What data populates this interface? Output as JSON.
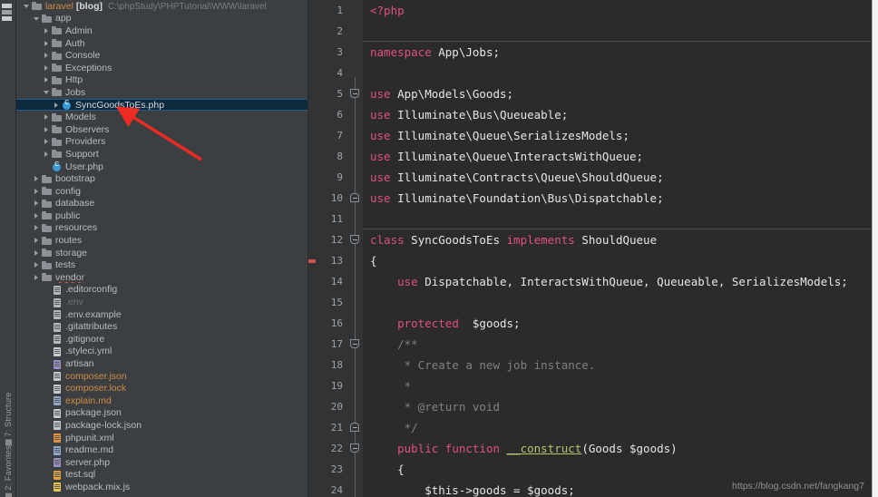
{
  "toolstrip": {
    "tabs": [
      {
        "label": "7: Structure",
        "icon": "structure-icon"
      },
      {
        "label": "2: Favorites",
        "icon": "favorites-icon"
      }
    ]
  },
  "project_tree": {
    "root": {
      "label": "laravel",
      "module": "[blog]",
      "path": "C:\\phpStudy\\PHPTutorial\\WWW\\laravel"
    },
    "items": [
      {
        "label": "laravel",
        "module": "[blog]",
        "path": "C:\\phpStudy\\PHPTutorial\\WWW\\laravel",
        "indent": 0,
        "twisty": "open",
        "icon": "folder-icon",
        "style": "root"
      },
      {
        "label": "app",
        "indent": 1,
        "twisty": "open",
        "icon": "folder-icon",
        "style": "normal"
      },
      {
        "label": "Admin",
        "indent": 2,
        "twisty": "closed",
        "icon": "folder-icon",
        "style": "normal"
      },
      {
        "label": "Auth",
        "indent": 2,
        "twisty": "closed",
        "icon": "folder-icon",
        "style": "normal"
      },
      {
        "label": "Console",
        "indent": 2,
        "twisty": "closed",
        "icon": "folder-icon",
        "style": "normal"
      },
      {
        "label": "Exceptions",
        "indent": 2,
        "twisty": "closed",
        "icon": "folder-icon",
        "style": "normal"
      },
      {
        "label": "Http",
        "indent": 2,
        "twisty": "closed",
        "icon": "folder-icon",
        "style": "normal"
      },
      {
        "label": "Jobs",
        "indent": 2,
        "twisty": "open",
        "icon": "folder-icon",
        "style": "normal"
      },
      {
        "label": "SyncGoodsToEs.php",
        "indent": 3,
        "twisty": "closed",
        "icon": "php-class-icon",
        "style": "selected"
      },
      {
        "label": "Models",
        "indent": 2,
        "twisty": "closed",
        "icon": "folder-icon",
        "style": "normal"
      },
      {
        "label": "Observers",
        "indent": 2,
        "twisty": "closed",
        "icon": "folder-icon",
        "style": "normal"
      },
      {
        "label": "Providers",
        "indent": 2,
        "twisty": "closed",
        "icon": "folder-icon",
        "style": "normal"
      },
      {
        "label": "Support",
        "indent": 2,
        "twisty": "closed",
        "icon": "folder-icon",
        "style": "normal"
      },
      {
        "label": "User.php",
        "indent": 2,
        "twisty": "none",
        "icon": "php-class-icon",
        "style": "normal"
      },
      {
        "label": "bootstrap",
        "indent": 1,
        "twisty": "closed",
        "icon": "folder-icon",
        "style": "normal"
      },
      {
        "label": "config",
        "indent": 1,
        "twisty": "closed",
        "icon": "folder-icon",
        "style": "normal"
      },
      {
        "label": "database",
        "indent": 1,
        "twisty": "closed",
        "icon": "folder-icon",
        "style": "normal"
      },
      {
        "label": "public",
        "indent": 1,
        "twisty": "closed",
        "icon": "folder-icon",
        "style": "normal"
      },
      {
        "label": "resources",
        "indent": 1,
        "twisty": "closed",
        "icon": "folder-icon",
        "style": "normal"
      },
      {
        "label": "routes",
        "indent": 1,
        "twisty": "closed",
        "icon": "folder-icon",
        "style": "normal"
      },
      {
        "label": "storage",
        "indent": 1,
        "twisty": "closed",
        "icon": "folder-icon",
        "style": "normal"
      },
      {
        "label": "tests",
        "indent": 1,
        "twisty": "closed",
        "icon": "folder-icon",
        "style": "normal"
      },
      {
        "label": "vendor",
        "indent": 1,
        "twisty": "closed",
        "icon": "folder-icon",
        "style": "wavy"
      },
      {
        "label": ".editorconfig",
        "indent": 2,
        "twisty": "none",
        "icon": "file-icon",
        "style": "normal"
      },
      {
        "label": ".env",
        "indent": 2,
        "twisty": "none",
        "icon": "file-icon",
        "style": "dim"
      },
      {
        "label": ".env.example",
        "indent": 2,
        "twisty": "none",
        "icon": "file-icon",
        "style": "normal"
      },
      {
        "label": ".gitattributes",
        "indent": 2,
        "twisty": "none",
        "icon": "file-icon",
        "style": "normal"
      },
      {
        "label": ".gitignore",
        "indent": 2,
        "twisty": "none",
        "icon": "file-icon",
        "style": "normal"
      },
      {
        "label": ".styleci.yml",
        "indent": 2,
        "twisty": "none",
        "icon": "yaml-file-icon",
        "style": "normal"
      },
      {
        "label": "artisan",
        "indent": 2,
        "twisty": "none",
        "icon": "php-file-icon",
        "style": "normal"
      },
      {
        "label": "composer.json",
        "indent": 2,
        "twisty": "none",
        "icon": "json-file-icon",
        "style": "orange"
      },
      {
        "label": "composer.lock",
        "indent": 2,
        "twisty": "none",
        "icon": "json-file-icon",
        "style": "orange"
      },
      {
        "label": "explain.md",
        "indent": 2,
        "twisty": "none",
        "icon": "markdown-file-icon",
        "style": "orange"
      },
      {
        "label": "package.json",
        "indent": 2,
        "twisty": "none",
        "icon": "json-file-icon",
        "style": "normal"
      },
      {
        "label": "package-lock.json",
        "indent": 2,
        "twisty": "none",
        "icon": "json-file-icon",
        "style": "normal"
      },
      {
        "label": "phpunit.xml",
        "indent": 2,
        "twisty": "none",
        "icon": "xml-file-icon",
        "style": "normal"
      },
      {
        "label": "readme.md",
        "indent": 2,
        "twisty": "none",
        "icon": "markdown-file-icon",
        "style": "normal"
      },
      {
        "label": "server.php",
        "indent": 2,
        "twisty": "none",
        "icon": "php-file-icon",
        "style": "normal"
      },
      {
        "label": "test.sql",
        "indent": 2,
        "twisty": "none",
        "icon": "sql-file-icon",
        "style": "normal"
      },
      {
        "label": "webpack.mix.js",
        "indent": 2,
        "twisty": "none",
        "icon": "js-file-icon",
        "style": "normal"
      }
    ],
    "annotation": {
      "type": "red-arrow",
      "color": "#ee2b22",
      "points_to": "SyncGoodsToEs.php"
    }
  },
  "editor": {
    "line_numbers": [
      1,
      2,
      3,
      4,
      5,
      6,
      7,
      8,
      9,
      10,
      11,
      12,
      13,
      14,
      15,
      16,
      17,
      18,
      19,
      20,
      21,
      22,
      23,
      24
    ],
    "lines": [
      {
        "n": 1,
        "tokens": [
          {
            "t": "<?php",
            "c": "k-pink"
          }
        ]
      },
      {
        "n": 2,
        "tokens": []
      },
      {
        "n": 3,
        "tokens": [
          {
            "t": "namespace",
            "c": "k-pink"
          },
          {
            "t": " App\\Jobs;",
            "c": "k-txt"
          }
        ]
      },
      {
        "n": 4,
        "tokens": []
      },
      {
        "n": 5,
        "tokens": [
          {
            "t": "use",
            "c": "k-pink"
          },
          {
            "t": " App\\Models\\Goods;",
            "c": "k-txt"
          }
        ]
      },
      {
        "n": 6,
        "tokens": [
          {
            "t": "use",
            "c": "k-pink"
          },
          {
            "t": " Illuminate\\Bus\\Queueable;",
            "c": "k-txt"
          }
        ]
      },
      {
        "n": 7,
        "tokens": [
          {
            "t": "use",
            "c": "k-pink"
          },
          {
            "t": " Illuminate\\Queue\\SerializesModels;",
            "c": "k-txt"
          }
        ]
      },
      {
        "n": 8,
        "tokens": [
          {
            "t": "use",
            "c": "k-pink"
          },
          {
            "t": " Illuminate\\Queue\\InteractsWithQueue;",
            "c": "k-txt"
          }
        ]
      },
      {
        "n": 9,
        "tokens": [
          {
            "t": "use",
            "c": "k-pink"
          },
          {
            "t": " Illuminate\\Contracts\\Queue\\ShouldQueue;",
            "c": "k-txt"
          }
        ]
      },
      {
        "n": 10,
        "tokens": [
          {
            "t": "use",
            "c": "k-pink"
          },
          {
            "t": " Illuminate\\Foundation\\Bus\\Dispatchable;",
            "c": "k-txt"
          }
        ]
      },
      {
        "n": 11,
        "tokens": []
      },
      {
        "n": 12,
        "tokens": [
          {
            "t": "class",
            "c": "k-pink"
          },
          {
            "t": " SyncGoodsToEs ",
            "c": "k-txt"
          },
          {
            "t": "implements",
            "c": "k-pink"
          },
          {
            "t": " ShouldQueue",
            "c": "k-txt"
          }
        ]
      },
      {
        "n": 13,
        "tokens": [
          {
            "t": "{",
            "c": "k-txt"
          }
        ]
      },
      {
        "n": 14,
        "tokens": [
          {
            "t": "    ",
            "c": "k-txt"
          },
          {
            "t": "use",
            "c": "k-pink"
          },
          {
            "t": " Dispatchable, InteractsWithQueue, Queueable, SerializesModels;",
            "c": "k-txt"
          }
        ]
      },
      {
        "n": 15,
        "tokens": []
      },
      {
        "n": 16,
        "tokens": [
          {
            "t": "    ",
            "c": "k-txt"
          },
          {
            "t": "protected",
            "c": "k-pink"
          },
          {
            "t": "  $goods;",
            "c": "k-txt"
          }
        ]
      },
      {
        "n": 17,
        "tokens": [
          {
            "t": "    /**",
            "c": "k-cmt"
          }
        ]
      },
      {
        "n": 18,
        "tokens": [
          {
            "t": "     * Create a new job instance.",
            "c": "k-cmt"
          }
        ]
      },
      {
        "n": 19,
        "tokens": [
          {
            "t": "     *",
            "c": "k-cmt"
          }
        ]
      },
      {
        "n": 20,
        "tokens": [
          {
            "t": "     * @return void",
            "c": "k-cmt"
          }
        ]
      },
      {
        "n": 21,
        "tokens": [
          {
            "t": "     */",
            "c": "k-cmt"
          }
        ]
      },
      {
        "n": 22,
        "tokens": [
          {
            "t": "    ",
            "c": "k-txt"
          },
          {
            "t": "public function",
            "c": "k-pink"
          },
          {
            "t": " ",
            "c": "k-txt"
          },
          {
            "t": "__construct",
            "c": "k-fn"
          },
          {
            "t": "(Goods $goods)",
            "c": "k-txt"
          }
        ]
      },
      {
        "n": 23,
        "tokens": [
          {
            "t": "    {",
            "c": "k-txt"
          }
        ]
      },
      {
        "n": 24,
        "tokens": [
          {
            "t": "        $this->goods = $goods;",
            "c": "k-txt"
          }
        ]
      }
    ],
    "fold_markers": [
      {
        "line": 5,
        "dir": "down"
      },
      {
        "line": 10,
        "dir": "up"
      },
      {
        "line": 12,
        "dir": "down"
      },
      {
        "line": 17,
        "dir": "down"
      },
      {
        "line": 21,
        "dir": "up"
      },
      {
        "line": 22,
        "dir": "down"
      }
    ],
    "separators": [
      {
        "after_line": 2
      },
      {
        "after_line": 11
      }
    ],
    "error_marker": {
      "line": 13,
      "color": "#c75450"
    },
    "watermark": "https://blog.csdn.net/fangkang7"
  },
  "colors": {
    "panel_bg": "#3c3f41",
    "editor_bg": "#2b2b2b",
    "gutter_bg": "#313335",
    "selection_bg": "#0d293e",
    "selection_border": "#1f5c8f",
    "accent_keyword": "#e05080",
    "accent_comment": "#808080",
    "arrow_red": "#ee2b22",
    "folder_grey": "#8d9096",
    "text_default": "#b9bdc0"
  }
}
